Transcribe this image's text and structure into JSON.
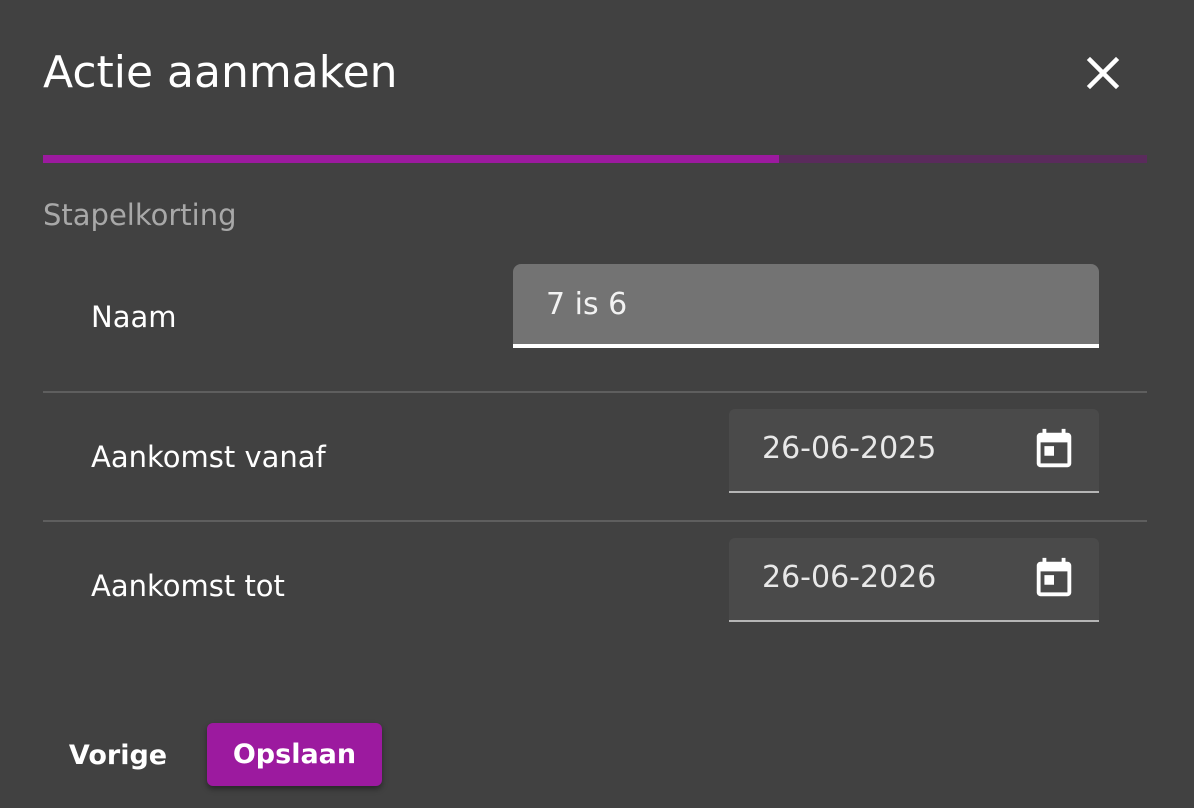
{
  "dialog": {
    "title": "Actie aanmaken",
    "close_icon": "close-icon",
    "progress_fraction": 0.667,
    "colors": {
      "background": "#414141",
      "accent": "#9c1a9f",
      "progress_track": "#5a2b5c"
    },
    "subtitle": "Stapelkorting"
  },
  "form": {
    "naam": {
      "label": "Naam",
      "value": "7 is 6"
    },
    "aankomst_vanaf": {
      "label": "Aankomst vanaf",
      "value": "26-06-2025",
      "icon": "calendar-icon"
    },
    "aankomst_tot": {
      "label": "Aankomst tot",
      "value": "26-06-2026",
      "icon": "calendar-icon"
    }
  },
  "footer": {
    "previous_label": "Vorige",
    "save_label": "Opslaan"
  }
}
